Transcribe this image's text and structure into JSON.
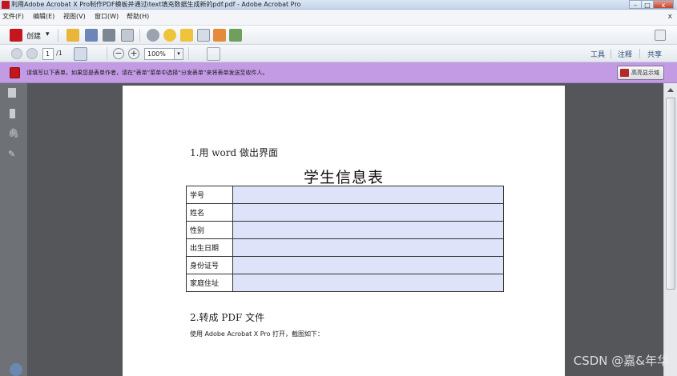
{
  "window": {
    "title": "利用Adobe Acrobat X Pro制作PDF模板并通过itext填充数据生成新的pdf.pdf - Adobe Acrobat Pro",
    "minimize": "–",
    "maximize": "□",
    "close": "x"
  },
  "menu": {
    "items": [
      "文件(F)",
      "编辑(E)",
      "视图(V)",
      "窗口(W)",
      "帮助(H)"
    ],
    "close": "x"
  },
  "toolbar": {
    "create_label": "创建",
    "create_arrow": "▾"
  },
  "navigation": {
    "current_page": "1",
    "total_pages": "/1",
    "zoom": "100%",
    "zoom_arrow": "▾",
    "zoom_out": "−",
    "zoom_in": "+",
    "right_tabs": [
      "工具",
      "注释",
      "共享"
    ]
  },
  "form_bar": {
    "message": "请填写以下表单。如果您是表单作者，请在“表单”菜单中选择“分发表单”来将表单发送至收件人。",
    "highlight_button": "高亮显示域"
  },
  "document": {
    "heading1": "1.用 word 做出界面",
    "table_title": "学生信息表",
    "rows": [
      {
        "label": "学号",
        "value": ""
      },
      {
        "label": "姓名",
        "value": ""
      },
      {
        "label": "性别",
        "value": ""
      },
      {
        "label": "出生日期",
        "value": ""
      },
      {
        "label": "身份证号",
        "value": ""
      },
      {
        "label": "家庭住址",
        "value": ""
      }
    ],
    "heading2": "2.转成 PDF 文件",
    "paragraph": "使用 Adobe Acrobat X Pro 打开，截图如下："
  },
  "watermark": "CSDN @嘉&年华",
  "colors": {
    "form_bar": "#c39be5",
    "field_fill": "#dfe3fa",
    "canvas": "#545659",
    "acrobat_red": "#c4161c"
  }
}
